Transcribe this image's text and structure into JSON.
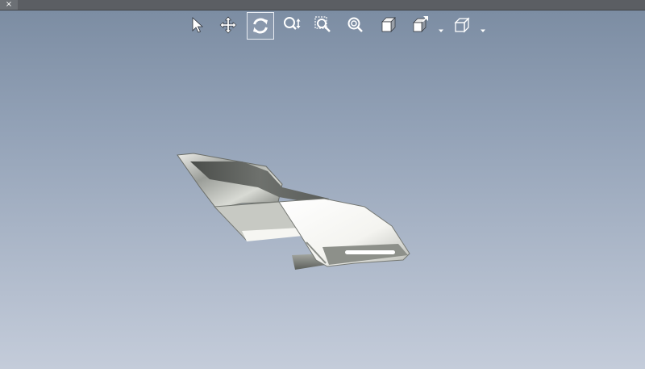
{
  "window": {
    "close_glyph": "×"
  },
  "toolbar": {
    "tools": [
      {
        "name": "select-icon",
        "active": false
      },
      {
        "name": "pan-icon",
        "active": false
      },
      {
        "name": "rotate-icon",
        "active": true
      },
      {
        "name": "zoom-icon",
        "active": false
      },
      {
        "name": "zoom-window-icon",
        "active": false
      },
      {
        "name": "zoom-fit-icon",
        "active": false
      },
      {
        "name": "shaded-cube-icon",
        "active": false
      },
      {
        "name": "standard-views-icon",
        "active": false,
        "has_dropdown": true
      },
      {
        "name": "wireframe-cube-icon",
        "active": false,
        "has_dropdown": true
      }
    ]
  },
  "colors": {
    "background_top": "#7a8ba1",
    "background_bottom": "#c4ccda",
    "title_bar": "#5b5e63",
    "icon": "#ffffff",
    "model_metal": "#c9cbc5"
  }
}
